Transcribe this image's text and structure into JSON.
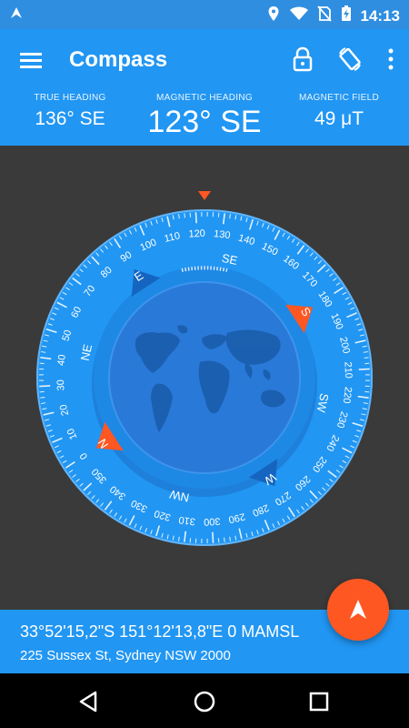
{
  "status_bar": {
    "time": "14:13",
    "icons": [
      "notification-arrow-icon",
      "location-icon",
      "wifi-icon",
      "no-sim-icon",
      "battery-charging-icon"
    ]
  },
  "app_bar": {
    "title": "Compass",
    "icons": [
      "menu-icon",
      "lock-icon",
      "screen-rotation-icon",
      "more-vert-icon"
    ]
  },
  "metrics": {
    "true_heading": {
      "label": "TRUE HEADING",
      "value": "136° SE"
    },
    "magnetic_heading": {
      "label": "MAGNETIC HEADING",
      "value": "123° SE"
    },
    "magnetic_field": {
      "label": "MAGNETIC FIELD",
      "value": "49 μT"
    }
  },
  "compass": {
    "heading_degrees": 123,
    "degree_labels": [
      "0",
      "10",
      "20",
      "30",
      "40",
      "50",
      "60",
      "70",
      "80",
      "90",
      "100",
      "110",
      "120",
      "130",
      "140",
      "150",
      "160",
      "170",
      "180",
      "190",
      "200",
      "210",
      "220",
      "230",
      "240",
      "250",
      "260",
      "270",
      "280",
      "290",
      "300",
      "310",
      "320",
      "330",
      "340",
      "350"
    ],
    "cardinals": {
      "N": "N",
      "NE": "NE",
      "E": "E",
      "SE": "SE",
      "S": "S",
      "SW": "SW",
      "W": "W",
      "NW": "NW"
    },
    "colors": {
      "accent": "#ff5722",
      "dial": "#2196f3",
      "inner": "#2979d8"
    }
  },
  "location": {
    "coordinates": "33°52'15,2\"S 151°12'13,8\"E 0 MAMSL",
    "address": "225 Sussex St, Sydney NSW 2000"
  },
  "fab": {
    "icon": "navigation-arrow-icon"
  },
  "nav_bar": {
    "icons": [
      "back-icon",
      "home-icon",
      "recents-icon"
    ]
  },
  "colors": {
    "primary": "#2196f3",
    "status": "#2f8ee0",
    "background": "#3a3a3a",
    "accent": "#ff5722"
  }
}
